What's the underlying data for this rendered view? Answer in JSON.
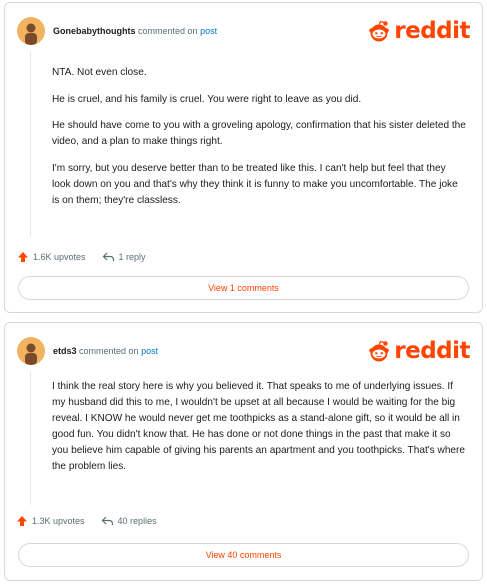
{
  "brand": {
    "logo_text": "reddit",
    "color": "#ff4500",
    "icon": "reddit-snoo-icon"
  },
  "comments": [
    {
      "author": "Gonebabythoughts",
      "verb": "commented on",
      "post_link": "post",
      "paragraphs": [
        "NTA. Not even close.",
        "He is cruel, and his family is cruel. You were right to leave as you did.",
        "He should have come to you with a groveling apology, confirmation that his sister deleted the video, and a plan to make things right.",
        "I'm sorry, but you deserve better than to be treated like this. I can't help but feel that they look down on you and that's why they think it is funny to make you uncomfortable. The joke is on them; they're classless."
      ],
      "upvotes": "1.6K upvotes",
      "replies": "1 reply",
      "view_label": "View 1 comments"
    },
    {
      "author": "etds3",
      "verb": "commented on",
      "post_link": "post",
      "paragraphs": [
        "I think the real story here is why you believed it. That speaks to me of underlying issues. If my husband did this to me, I wouldn't be upset at all because I would be waiting for the big reveal. I KNOW he would never get me toothpicks as a stand-alone gift, so it would be all in good fun. You didn't know that. He has done or not done things in the past that make it so you believe him capable of giving his parents an apartment and you toothpicks. That's where the problem lies."
      ],
      "upvotes": "1.3K upvotes",
      "replies": "40 replies",
      "view_label": "View 40 comments"
    }
  ],
  "icons": {
    "upvote": "upvote-arrow-icon",
    "reply": "reply-arrow-icon",
    "avatar": "avatar-icon"
  }
}
